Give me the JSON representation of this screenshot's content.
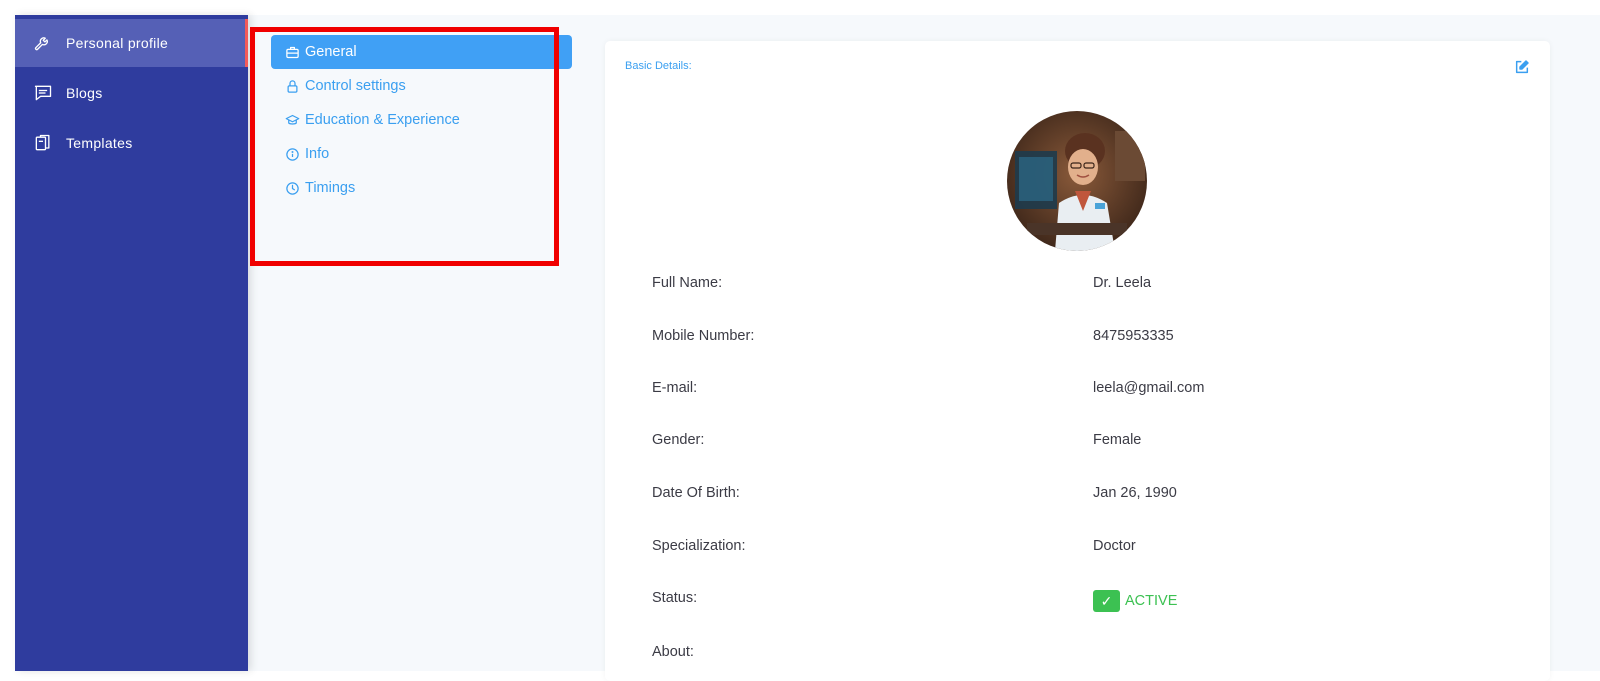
{
  "sidebar": {
    "items": [
      {
        "label": "Personal profile",
        "icon": "wrench-icon"
      },
      {
        "label": "Blogs",
        "icon": "chat-icon"
      },
      {
        "label": "Templates",
        "icon": "copy-icon"
      }
    ]
  },
  "subnav": {
    "items": [
      {
        "label": "General",
        "icon": "briefcase-icon"
      },
      {
        "label": "Control settings",
        "icon": "lock-icon"
      },
      {
        "label": "Education & Experience",
        "icon": "graduation-cap-icon"
      },
      {
        "label": "Info",
        "icon": "info-icon"
      },
      {
        "label": "Timings",
        "icon": "clock-icon"
      }
    ]
  },
  "card": {
    "title": "Basic Details:",
    "fields": [
      {
        "label": "Full Name:",
        "value": "Dr. Leela"
      },
      {
        "label": "Mobile Number:",
        "value": "8475953335"
      },
      {
        "label": "E-mail:",
        "value": "leela@gmail.com"
      },
      {
        "label": "Gender:",
        "value": "Female"
      },
      {
        "label": "Date Of Birth:",
        "value": "Jan 26, 1990"
      },
      {
        "label": "Specialization:",
        "value": "Doctor"
      }
    ],
    "status_label": "Status:",
    "status_check": "✓",
    "status_value": "ACTIVE",
    "about_label": "About:"
  },
  "colors": {
    "sidebar_bg": "#2f3c9e",
    "accent": "#40a0f5",
    "status_green": "#3cc152",
    "highlight_red": "#f00000"
  }
}
